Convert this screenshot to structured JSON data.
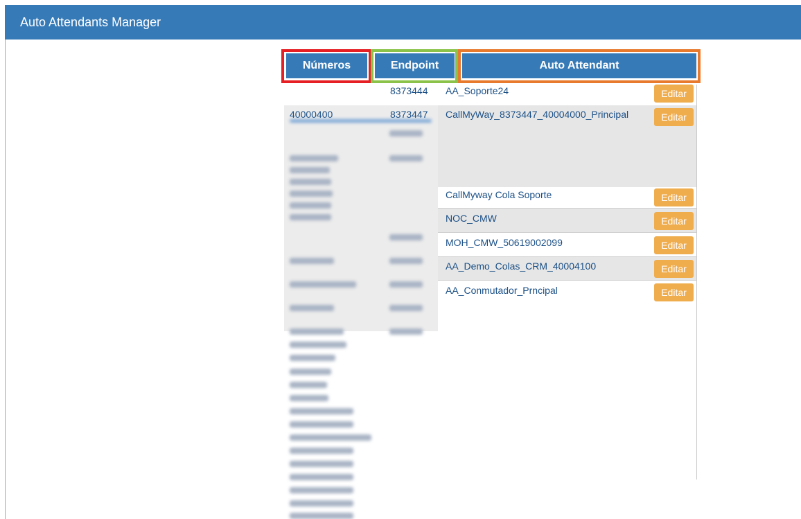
{
  "window": {
    "title": "Auto Attendants Manager"
  },
  "table": {
    "headers": {
      "numeros": "Números",
      "endpoint": "Endpoint",
      "auto_attendant": "Auto Attendant"
    },
    "highlight_colors": {
      "numeros": "#e51f24",
      "endpoint": "#8bc34a",
      "auto_attendant": "#e87a2e"
    },
    "rows": [
      {
        "numero": "",
        "endpoint": "8373444",
        "name": "AA_Soporte24",
        "action": "Editar"
      },
      {
        "numero": "40000400",
        "endpoint": "8373447",
        "name": "CallMyWay_8373447_40004000_Principal",
        "action": "Editar"
      },
      {
        "name": "CallMyway Cola Soporte",
        "action": "Editar"
      },
      {
        "name": "NOC_CMW",
        "action": "Editar"
      },
      {
        "name": "MOH_CMW_50619002099",
        "action": "Editar"
      },
      {
        "name": "AA_Demo_Colas_CRM_40004100",
        "action": "Editar"
      },
      {
        "name": "AA_Conmutador_Prncipal",
        "action": "Editar"
      }
    ]
  }
}
